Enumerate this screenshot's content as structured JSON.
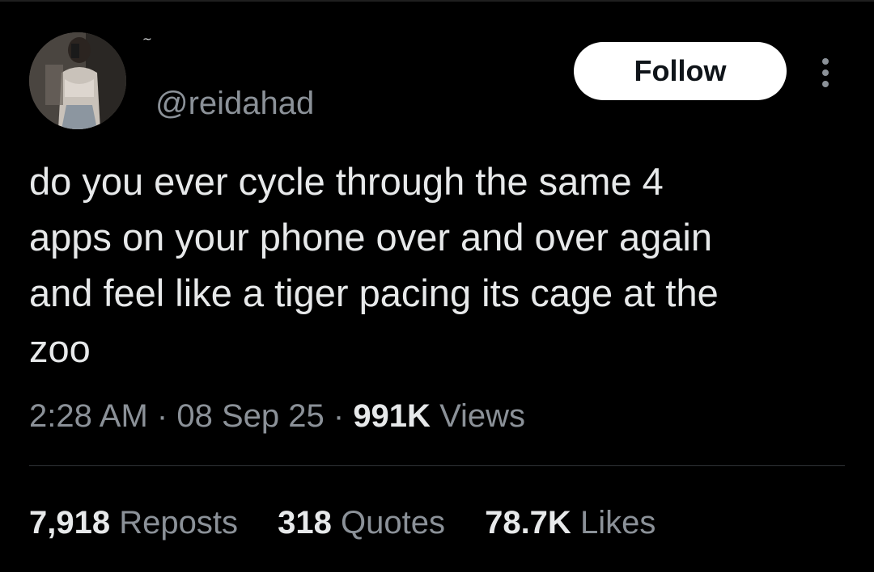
{
  "author": {
    "display_name": "~",
    "handle": "@reidahad",
    "avatar_icon": "profile-photo"
  },
  "actions": {
    "follow_label": "Follow",
    "more_icon": "more-vertical-icon"
  },
  "tweet": {
    "text": "do you ever cycle through the same 4\napps on your phone over and over again\nand feel like a tiger pacing its cage at the\nzoo"
  },
  "meta": {
    "time": "2:28 AM",
    "separator": "·",
    "date": "08 Sep 25",
    "views_count": "991K",
    "views_label": "Views"
  },
  "stats": {
    "reposts_count": "7,918",
    "reposts_label": "Reposts",
    "quotes_count": "318",
    "quotes_label": "Quotes",
    "likes_count": "78.7K",
    "likes_label": "Likes"
  },
  "colors": {
    "background": "#000000",
    "primary_text": "#e7e9ea",
    "secondary_text": "#8b9198",
    "follow_bg": "#ffffff",
    "divider": "#2f3336"
  }
}
